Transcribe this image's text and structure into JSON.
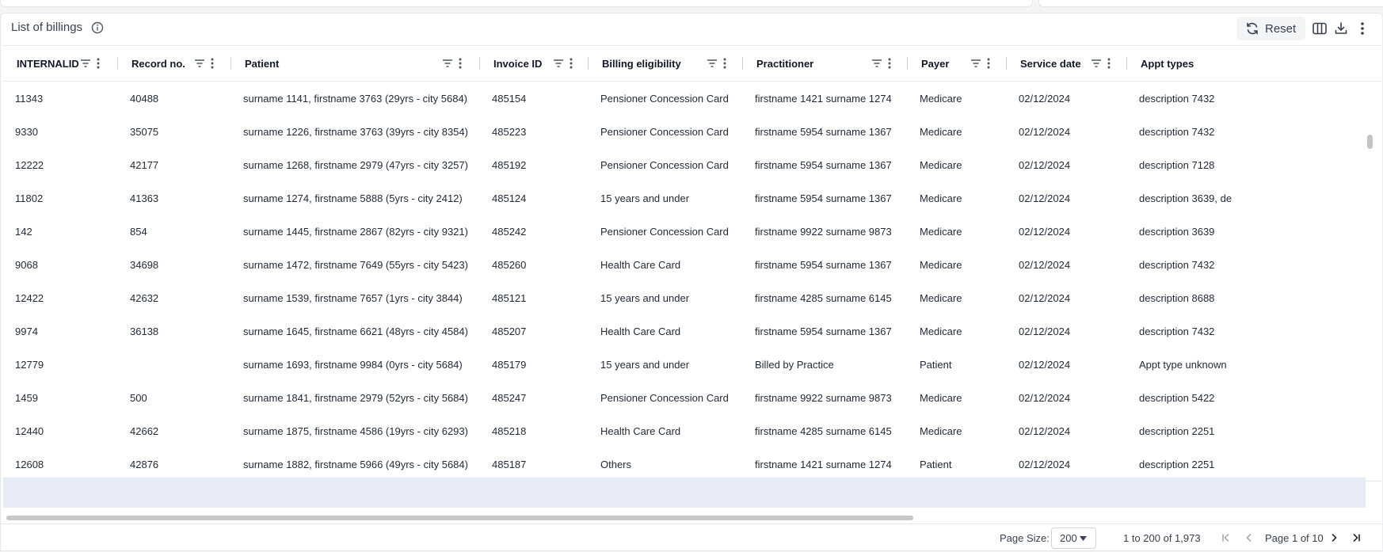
{
  "title": "List of billings",
  "toolbar": {
    "reset_label": "Reset"
  },
  "columns": [
    "INTERNALID",
    "Record no.",
    "Patient",
    "Invoice ID",
    "Billing eligibility",
    "Practitioner",
    "Payer",
    "Service date",
    "Appt types"
  ],
  "rows": [
    [
      "11343",
      "40488",
      "surname 1141, firstname 3763 (29yrs - city 5684)",
      "485154",
      "Pensioner Concession Card",
      "firstname 1421 surname 1274",
      "Medicare",
      "02/12/2024",
      "description 7432"
    ],
    [
      "9330",
      "35075",
      "surname 1226, firstname 3763 (39yrs - city 8354)",
      "485223",
      "Pensioner Concession Card",
      "firstname 5954 surname 1367",
      "Medicare",
      "02/12/2024",
      "description 7432"
    ],
    [
      "12222",
      "42177",
      "surname 1268, firstname 2979 (47yrs - city 3257)",
      "485192",
      "Pensioner Concession Card",
      "firstname 5954 surname 1367",
      "Medicare",
      "02/12/2024",
      "description 7128"
    ],
    [
      "11802",
      "41363",
      "surname 1274, firstname 5888 (5yrs - city 2412)",
      "485124",
      "15 years and under",
      "firstname 5954 surname 1367",
      "Medicare",
      "02/12/2024",
      "description 3639, de"
    ],
    [
      "142",
      "854",
      "surname 1445, firstname 2867 (82yrs - city 9321)",
      "485242",
      "Pensioner Concession Card",
      "firstname 9922 surname 9873",
      "Medicare",
      "02/12/2024",
      "description 3639"
    ],
    [
      "9068",
      "34698",
      "surname 1472, firstname 7649 (55yrs - city 5423)",
      "485260",
      "Health Care Card",
      "firstname 5954 surname 1367",
      "Medicare",
      "02/12/2024",
      "description 7432"
    ],
    [
      "12422",
      "42632",
      "surname 1539, firstname 7657 (1yrs - city 3844)",
      "485121",
      "15 years and under",
      "firstname 4285 surname 6145",
      "Medicare",
      "02/12/2024",
      "description 8688"
    ],
    [
      "9974",
      "36138",
      "surname 1645, firstname 6621 (48yrs - city 4584)",
      "485207",
      "Health Care Card",
      "firstname 5954 surname 1367",
      "Medicare",
      "02/12/2024",
      "description 7432"
    ],
    [
      "12779",
      "",
      "surname 1693, firstname 9984 (0yrs - city 5684)",
      "485179",
      "15 years and under",
      "Billed by Practice",
      "Patient",
      "02/12/2024",
      "Appt type unknown"
    ],
    [
      "1459",
      "500",
      "surname 1841, firstname 2979 (52yrs - city 5684)",
      "485247",
      "Pensioner Concession Card",
      "firstname 9922 surname 9873",
      "Medicare",
      "02/12/2024",
      "description 5422"
    ],
    [
      "12440",
      "42662",
      "surname 1875, firstname 4586 (19yrs - city 6293)",
      "485218",
      "Health Care Card",
      "firstname 4285 surname 6145",
      "Medicare",
      "02/12/2024",
      "description 2251"
    ],
    [
      "12608",
      "42876",
      "surname 1882, firstname 5966 (49yrs - city 5684)",
      "485187",
      "Others",
      "firstname 1421 surname 1274",
      "Patient",
      "02/12/2024",
      "description 2251"
    ]
  ],
  "pagination": {
    "page_size_label": "Page Size:",
    "page_size_value": "200",
    "range_text": "1 to 200 of 1,973",
    "page_text": "Page 1 of 10"
  },
  "icons": {
    "info": "info-icon",
    "reset": "refresh-icon",
    "columns": "columns-icon",
    "download": "download-icon",
    "more": "more-vertical-icon",
    "filter": "filter-icon"
  },
  "colors": {
    "empty_area": "#e6ebf5",
    "border": "#e5e7eb",
    "text": "#1f2937"
  }
}
